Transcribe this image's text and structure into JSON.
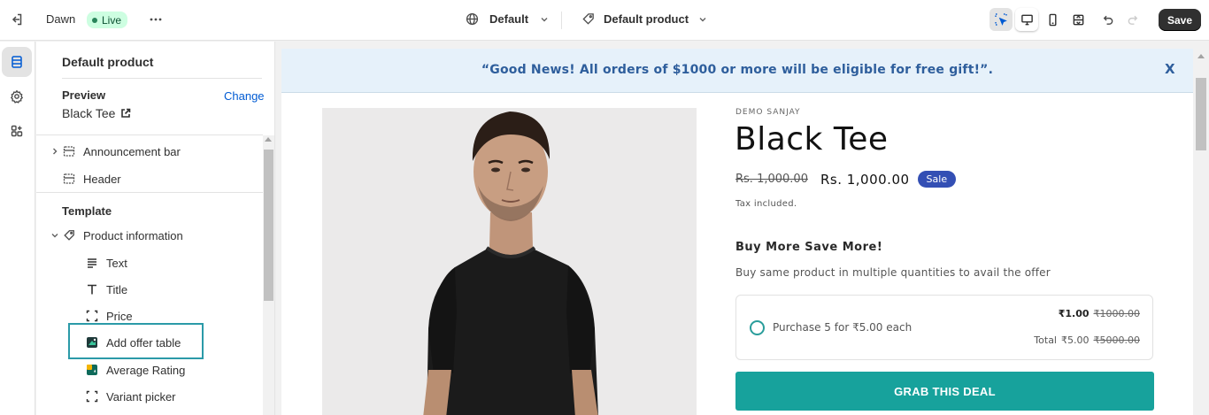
{
  "topbar": {
    "theme_name": "Dawn",
    "status": "Live",
    "template_select": "Default",
    "product_select": "Default product",
    "save_label": "Save"
  },
  "sidebar": {
    "title": "Default product",
    "preview_label": "Preview",
    "change_label": "Change",
    "preview_value": "Black Tee",
    "header_items": [
      {
        "label": "Announcement bar",
        "icon": "section-icon"
      },
      {
        "label": "Header",
        "icon": "section-icon"
      }
    ],
    "template_label": "Template",
    "section_label": "Product information",
    "blocks": [
      {
        "label": "Text",
        "icon": "text-lines-icon"
      },
      {
        "label": "Title",
        "icon": "title-t-icon"
      },
      {
        "label": "Price",
        "icon": "price-frame-icon"
      },
      {
        "label": "Add offer table",
        "icon": "app-block-icon"
      },
      {
        "label": "Average Rating",
        "icon": "rating-app-icon"
      },
      {
        "label": "Variant picker",
        "icon": "variant-frame-icon"
      }
    ]
  },
  "store": {
    "announcement": "“Good News! All orders of $1000 or more will be eligible for free gift!”.",
    "announcement_close": "X",
    "vendor": "DEMO SANJAY",
    "product_title": "Black Tee",
    "compare_price": "Rs. 1,000.00",
    "price": "Rs. 1,000.00",
    "sale_badge": "Sale",
    "tax_note": "Tax included.",
    "offer_heading": "Buy More Save More!",
    "offer_sub": "Buy same product in multiple quantities to avail the offer",
    "offer": {
      "label": "Purchase 5 for ₹5.00 each",
      "unit_price": "₹1.00",
      "unit_old": "₹1000.00",
      "total_label": "Total",
      "total_price": "₹5.00",
      "total_old": "₹5000.00"
    },
    "cta": "GRAB THIS DEAL"
  },
  "colors": {
    "accent_teal": "#17a29c",
    "sale_blue": "#334fb4",
    "announce_bg": "#e6f1fa",
    "highlight": "#2b9aa8"
  }
}
